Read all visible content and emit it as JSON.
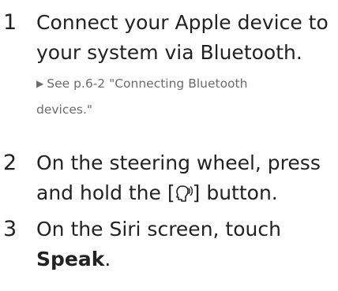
{
  "steps": [
    {
      "number": "1",
      "line1": "Connect your Apple device to",
      "line2": "your system via Bluetooth.",
      "reference_line1": "See p.6-2 \"Connecting Bluetooth",
      "reference_line2": "devices.\""
    },
    {
      "number": "2",
      "line1": "On the steering wheel, press",
      "line2_before_icon": "and hold the [",
      "icon": "voice-command-icon",
      "line2_after_icon": "] button."
    },
    {
      "number": "3",
      "line1": "On the Siri screen, touch",
      "line2_bold": "Speak",
      "line2_after": "."
    }
  ],
  "colors": {
    "text": "#222222",
    "reference": "#6b6b6b"
  }
}
